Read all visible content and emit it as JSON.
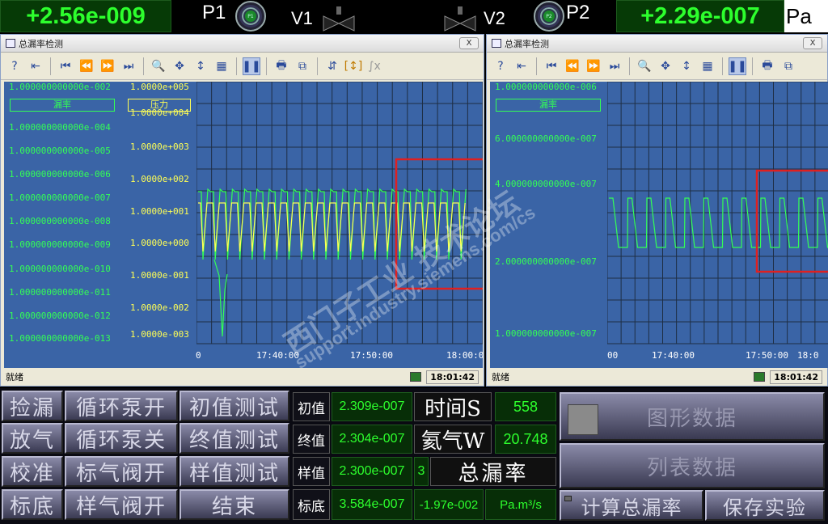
{
  "header": {
    "p1_value": "+2.56e-009",
    "p1_label": "P1",
    "v1_label": "V1",
    "v2_label": "V2",
    "p2_label": "P2",
    "p2_value": "+2.29e-007",
    "unit": "Pa",
    "gauge1_text": "P1",
    "gauge2_text": "P2"
  },
  "left_window": {
    "title": "总漏率检测",
    "close": "X",
    "legend_leak": "漏率",
    "legend_pressure": "压力",
    "leak_axis": [
      "1.000000000000e-002",
      "1.000000000000e-004",
      "1.000000000000e-005",
      "1.000000000000e-006",
      "1.000000000000e-007",
      "1.000000000000e-008",
      "1.000000000000e-009",
      "1.000000000000e-010",
      "1.000000000000e-011",
      "1.000000000000e-012",
      "1.000000000000e-013"
    ],
    "pressure_axis": [
      "1.0000e+005",
      "1.0000e+004",
      "1.0000e+003",
      "1.0000e+002",
      "1.0000e+001",
      "1.0000e+000",
      "1.0000e-001",
      "1.0000e-002",
      "1.0000e-003"
    ],
    "x_ticks": [
      "0",
      "17:40:00",
      "17:50:00",
      "18:00:0"
    ],
    "status_text": "就绪",
    "status_time": "18:01:42"
  },
  "right_window": {
    "title": "总漏率检测",
    "close": "X",
    "legend_leak": "漏率",
    "leak_axis": [
      "1.000000000000e-006",
      "6.000000000000e-007",
      "4.000000000000e-007",
      "2.000000000000e-007",
      "1.000000000000e-007"
    ],
    "x_ticks": [
      "00",
      "17:40:00",
      "17:50:00",
      "18:0"
    ],
    "status_text": "就绪",
    "status_time": "18:01:42"
  },
  "toolbar_icons": [
    "help-icon",
    "export-icon",
    "first-icon",
    "rewind-icon",
    "forward-icon",
    "last-icon",
    "zoom-icon",
    "pan-icon",
    "scale-icon",
    "reset-icon",
    "pause-icon",
    "print-icon",
    "copy-icon",
    "cursor-icon",
    "bracket-icon",
    "formula-icon"
  ],
  "panel": {
    "btn_leak_check": "捡漏",
    "btn_pump_on": "循环泵开",
    "btn_init_test": "初值测试",
    "btn_vent": "放气",
    "btn_pump_off": "循环泵关",
    "btn_final_test": "终值测试",
    "btn_calibrate": "校准",
    "btn_std_gas_valve": "标气阀开",
    "btn_sample_test": "样值测试",
    "btn_baseline": "标底",
    "btn_sample_valve": "样气阀开",
    "btn_end": "结束",
    "lbl_init": "初值",
    "val_init": "2.309e-007",
    "lbl_final": "终值",
    "val_final": "2.304e-007",
    "lbl_sample": "样值",
    "val_sample": "2.300e-007",
    "lbl_base": "标底",
    "val_base": "3.584e-007",
    "lbl_time": "时间S",
    "val_time": "558",
    "lbl_helium": "氦气W",
    "val_helium": "20.748",
    "count": "3",
    "lbl_total": "总漏率",
    "val_total": "-1.97e-002",
    "unit_total": "Pa.m³/s",
    "btn_graph": "图形数据",
    "btn_list": "列表数据",
    "btn_calc": "计算总漏率",
    "btn_save": "保存实验"
  },
  "watermark": {
    "line1": "西门子工业 技术论坛",
    "line2": "support.industry.siemens.com/cs"
  },
  "colors": {
    "plot_bg": "#3a64a6",
    "leak_trace": "#33ff55",
    "pressure_trace": "#ffff55",
    "highlight": "#e02020"
  }
}
